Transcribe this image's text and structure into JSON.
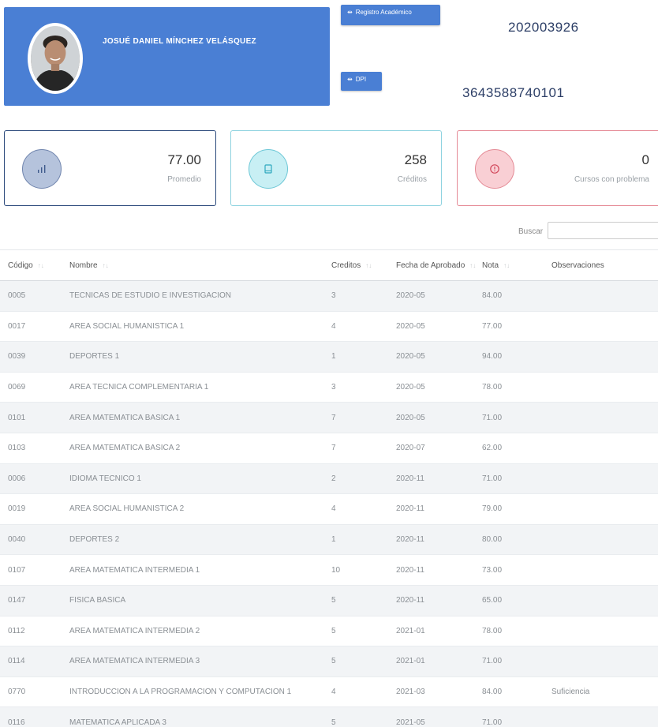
{
  "profile": {
    "name": "JOSUÉ DANIEL MÍNCHEZ VELÁSQUEZ",
    "registro_label": "Registro Académico",
    "registro_value": "202003926",
    "dpi_label": "DPI",
    "dpi_value": "3643588740101"
  },
  "stats": {
    "promedio": {
      "value": "77.00",
      "label": "Promedio"
    },
    "creditos": {
      "value": "258",
      "label": "Créditos"
    },
    "problema": {
      "value": "0",
      "label": "Cursos con problema"
    }
  },
  "search": {
    "label": "Buscar",
    "value": ""
  },
  "table": {
    "headers": [
      "Código",
      "Nombre",
      "Creditos",
      "Fecha de Aprobado",
      "Nota",
      "Observaciones"
    ],
    "rows": [
      [
        "0005",
        "TECNICAS DE ESTUDIO E INVESTIGACION",
        "3",
        "2020-05",
        "84.00",
        ""
      ],
      [
        "0017",
        "AREA SOCIAL HUMANISTICA 1",
        "4",
        "2020-05",
        "77.00",
        ""
      ],
      [
        "0039",
        "DEPORTES 1",
        "1",
        "2020-05",
        "94.00",
        ""
      ],
      [
        "0069",
        "AREA TECNICA COMPLEMENTARIA 1",
        "3",
        "2020-05",
        "78.00",
        ""
      ],
      [
        "0101",
        "AREA MATEMATICA BASICA 1",
        "7",
        "2020-05",
        "71.00",
        ""
      ],
      [
        "0103",
        "AREA MATEMATICA BASICA 2",
        "7",
        "2020-07",
        "62.00",
        ""
      ],
      [
        "0006",
        "IDIOMA TECNICO 1",
        "2",
        "2020-11",
        "71.00",
        ""
      ],
      [
        "0019",
        "AREA SOCIAL HUMANISTICA 2",
        "4",
        "2020-11",
        "79.00",
        ""
      ],
      [
        "0040",
        "DEPORTES 2",
        "1",
        "2020-11",
        "80.00",
        ""
      ],
      [
        "0107",
        "AREA MATEMATICA INTERMEDIA 1",
        "10",
        "2020-11",
        "73.00",
        ""
      ],
      [
        "0147",
        "FISICA BASICA",
        "5",
        "2020-11",
        "65.00",
        ""
      ],
      [
        "0112",
        "AREA MATEMATICA INTERMEDIA 2",
        "5",
        "2021-01",
        "78.00",
        ""
      ],
      [
        "0114",
        "AREA MATEMATICA INTERMEDIA 3",
        "5",
        "2021-01",
        "71.00",
        ""
      ],
      [
        "0770",
        "INTRODUCCION A LA PROGRAMACION Y COMPUTACION 1",
        "4",
        "2021-03",
        "84.00",
        "Suficiencia"
      ],
      [
        "0116",
        "MATEMATICA APLICADA 3",
        "5",
        "2021-05",
        "71.00",
        ""
      ]
    ]
  },
  "icons": {
    "promedio": "bar-chart-icon",
    "creditos": "book-icon",
    "problema": "alert-circle-icon",
    "tag": "arrow-left-right-icon"
  },
  "colors": {
    "primary": "#4a7fd4",
    "promedio": "#2c4a7c",
    "creditos": "#6cc7d6",
    "problema": "#e48a95"
  }
}
